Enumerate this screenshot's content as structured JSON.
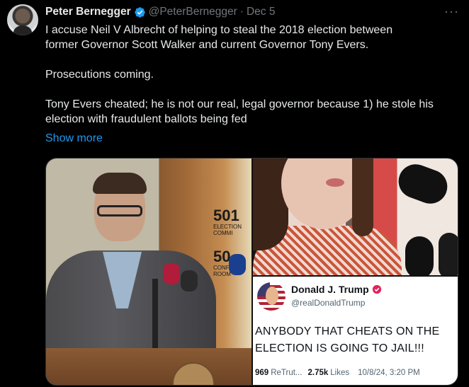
{
  "tweet": {
    "author_name": "Peter Bernegger",
    "handle": "@PeterBernegger",
    "separator": "·",
    "date": "Dec 5",
    "more_label": "···",
    "text_lines": [
      "I accuse Neil V Albrecht of helping to steal the 2018 election between",
      "former Governor Scott Walker and current Governor Tony Evers.",
      "",
      "Prosecutions coming.",
      "",
      "Tony Evers cheated; he is not our real, legal governor because 1) he stole his",
      "election with fraudulent ballots being fed"
    ],
    "show_more": "Show more",
    "colors": {
      "accent": "#1d9bf0",
      "text": "#e7e9ea",
      "secondary": "#71767b",
      "background": "#000000"
    }
  },
  "media": {
    "left_photo": {
      "sign_number_1": "501",
      "sign_text_1": "ELECTION COMMI",
      "sign_number_2": "50",
      "sign_text_2": "CONFE ROOM"
    },
    "embedded_post": {
      "author_name": "Donald J. Trump",
      "handle": "@realDonaldTrump",
      "body": "ANYBODY THAT CHEATS ON THE ELECTION IS GOING TO JAIL!!!",
      "retruths_count": "969",
      "retruths_label": "ReTrut...",
      "likes_count": "2.75k",
      "likes_label": "Likes",
      "date": "10/8/24, 3:20 PM"
    }
  }
}
